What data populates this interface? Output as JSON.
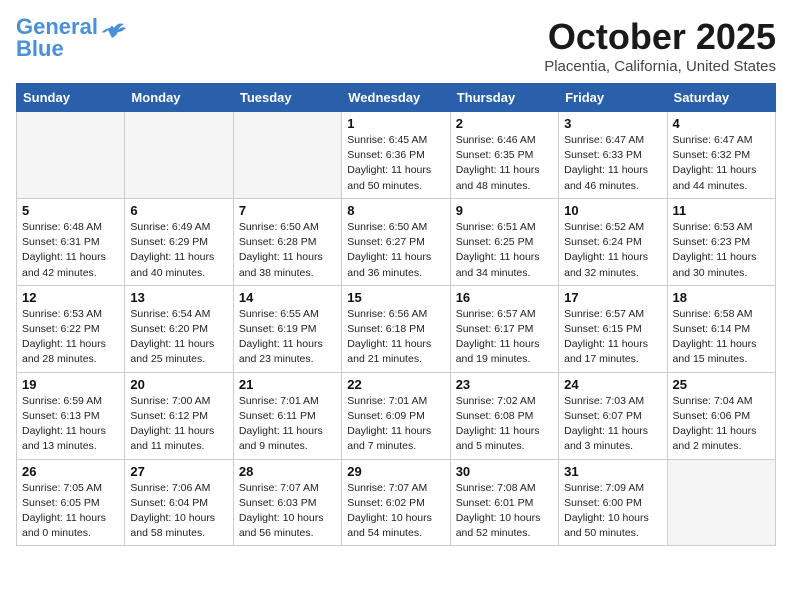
{
  "header": {
    "logo_line1": "General",
    "logo_line2": "Blue",
    "month": "October 2025",
    "location": "Placentia, California, United States"
  },
  "days_of_week": [
    "Sunday",
    "Monday",
    "Tuesday",
    "Wednesday",
    "Thursday",
    "Friday",
    "Saturday"
  ],
  "weeks": [
    [
      {
        "day": "",
        "info": ""
      },
      {
        "day": "",
        "info": ""
      },
      {
        "day": "",
        "info": ""
      },
      {
        "day": "1",
        "info": "Sunrise: 6:45 AM\nSunset: 6:36 PM\nDaylight: 11 hours\nand 50 minutes."
      },
      {
        "day": "2",
        "info": "Sunrise: 6:46 AM\nSunset: 6:35 PM\nDaylight: 11 hours\nand 48 minutes."
      },
      {
        "day": "3",
        "info": "Sunrise: 6:47 AM\nSunset: 6:33 PM\nDaylight: 11 hours\nand 46 minutes."
      },
      {
        "day": "4",
        "info": "Sunrise: 6:47 AM\nSunset: 6:32 PM\nDaylight: 11 hours\nand 44 minutes."
      }
    ],
    [
      {
        "day": "5",
        "info": "Sunrise: 6:48 AM\nSunset: 6:31 PM\nDaylight: 11 hours\nand 42 minutes."
      },
      {
        "day": "6",
        "info": "Sunrise: 6:49 AM\nSunset: 6:29 PM\nDaylight: 11 hours\nand 40 minutes."
      },
      {
        "day": "7",
        "info": "Sunrise: 6:50 AM\nSunset: 6:28 PM\nDaylight: 11 hours\nand 38 minutes."
      },
      {
        "day": "8",
        "info": "Sunrise: 6:50 AM\nSunset: 6:27 PM\nDaylight: 11 hours\nand 36 minutes."
      },
      {
        "day": "9",
        "info": "Sunrise: 6:51 AM\nSunset: 6:25 PM\nDaylight: 11 hours\nand 34 minutes."
      },
      {
        "day": "10",
        "info": "Sunrise: 6:52 AM\nSunset: 6:24 PM\nDaylight: 11 hours\nand 32 minutes."
      },
      {
        "day": "11",
        "info": "Sunrise: 6:53 AM\nSunset: 6:23 PM\nDaylight: 11 hours\nand 30 minutes."
      }
    ],
    [
      {
        "day": "12",
        "info": "Sunrise: 6:53 AM\nSunset: 6:22 PM\nDaylight: 11 hours\nand 28 minutes."
      },
      {
        "day": "13",
        "info": "Sunrise: 6:54 AM\nSunset: 6:20 PM\nDaylight: 11 hours\nand 25 minutes."
      },
      {
        "day": "14",
        "info": "Sunrise: 6:55 AM\nSunset: 6:19 PM\nDaylight: 11 hours\nand 23 minutes."
      },
      {
        "day": "15",
        "info": "Sunrise: 6:56 AM\nSunset: 6:18 PM\nDaylight: 11 hours\nand 21 minutes."
      },
      {
        "day": "16",
        "info": "Sunrise: 6:57 AM\nSunset: 6:17 PM\nDaylight: 11 hours\nand 19 minutes."
      },
      {
        "day": "17",
        "info": "Sunrise: 6:57 AM\nSunset: 6:15 PM\nDaylight: 11 hours\nand 17 minutes."
      },
      {
        "day": "18",
        "info": "Sunrise: 6:58 AM\nSunset: 6:14 PM\nDaylight: 11 hours\nand 15 minutes."
      }
    ],
    [
      {
        "day": "19",
        "info": "Sunrise: 6:59 AM\nSunset: 6:13 PM\nDaylight: 11 hours\nand 13 minutes."
      },
      {
        "day": "20",
        "info": "Sunrise: 7:00 AM\nSunset: 6:12 PM\nDaylight: 11 hours\nand 11 minutes."
      },
      {
        "day": "21",
        "info": "Sunrise: 7:01 AM\nSunset: 6:11 PM\nDaylight: 11 hours\nand 9 minutes."
      },
      {
        "day": "22",
        "info": "Sunrise: 7:01 AM\nSunset: 6:09 PM\nDaylight: 11 hours\nand 7 minutes."
      },
      {
        "day": "23",
        "info": "Sunrise: 7:02 AM\nSunset: 6:08 PM\nDaylight: 11 hours\nand 5 minutes."
      },
      {
        "day": "24",
        "info": "Sunrise: 7:03 AM\nSunset: 6:07 PM\nDaylight: 11 hours\nand 3 minutes."
      },
      {
        "day": "25",
        "info": "Sunrise: 7:04 AM\nSunset: 6:06 PM\nDaylight: 11 hours\nand 2 minutes."
      }
    ],
    [
      {
        "day": "26",
        "info": "Sunrise: 7:05 AM\nSunset: 6:05 PM\nDaylight: 11 hours\nand 0 minutes."
      },
      {
        "day": "27",
        "info": "Sunrise: 7:06 AM\nSunset: 6:04 PM\nDaylight: 10 hours\nand 58 minutes."
      },
      {
        "day": "28",
        "info": "Sunrise: 7:07 AM\nSunset: 6:03 PM\nDaylight: 10 hours\nand 56 minutes."
      },
      {
        "day": "29",
        "info": "Sunrise: 7:07 AM\nSunset: 6:02 PM\nDaylight: 10 hours\nand 54 minutes."
      },
      {
        "day": "30",
        "info": "Sunrise: 7:08 AM\nSunset: 6:01 PM\nDaylight: 10 hours\nand 52 minutes."
      },
      {
        "day": "31",
        "info": "Sunrise: 7:09 AM\nSunset: 6:00 PM\nDaylight: 10 hours\nand 50 minutes."
      },
      {
        "day": "",
        "info": ""
      }
    ]
  ]
}
